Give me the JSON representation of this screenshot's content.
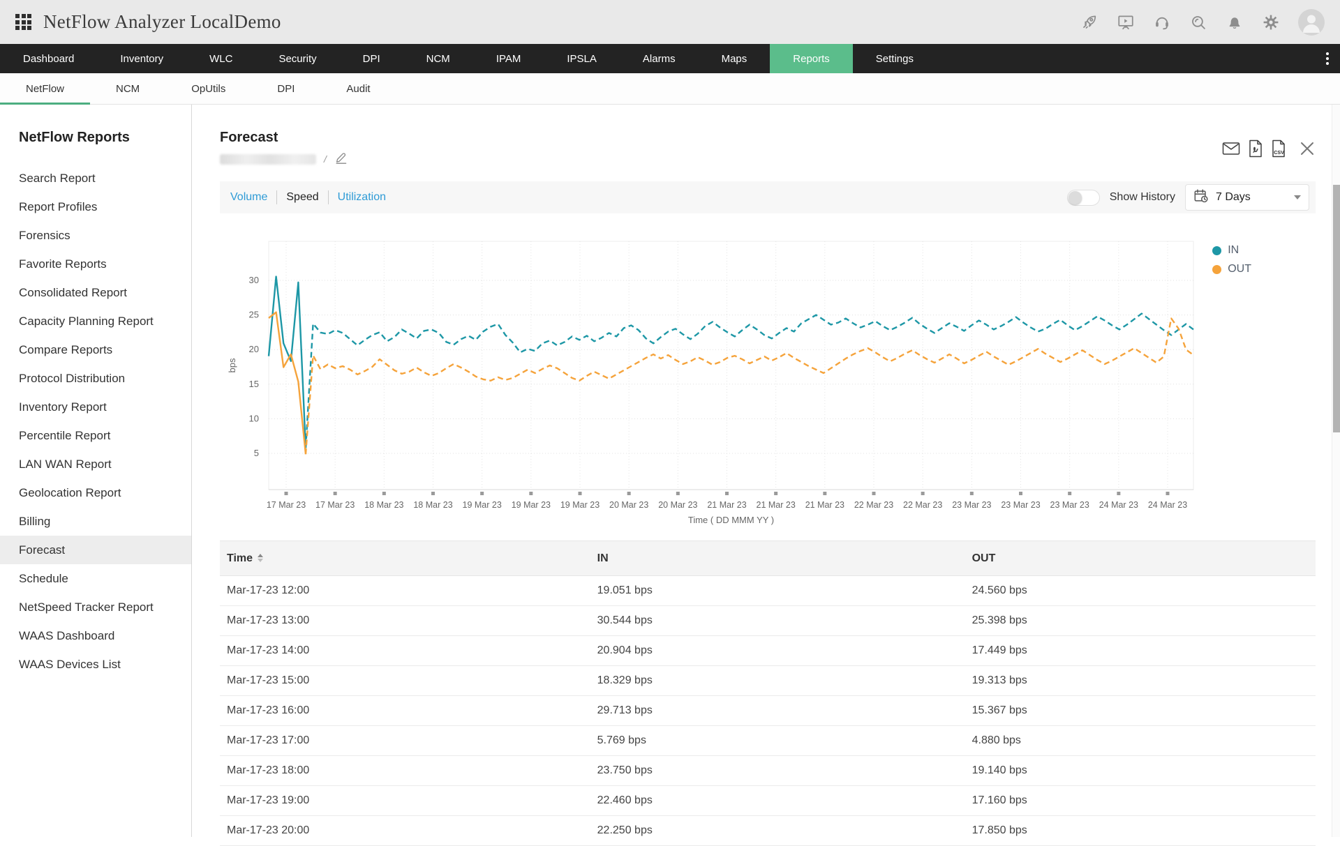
{
  "topbar": {
    "title": "NetFlow Analyzer LocalDemo",
    "icons": [
      "apps-grid-icon",
      "rocket-icon",
      "presentation-icon",
      "headset-icon",
      "search-icon",
      "bell-icon",
      "gear-icon",
      "avatar"
    ]
  },
  "navbar": {
    "items": [
      "Dashboard",
      "Inventory",
      "WLC",
      "Security",
      "DPI",
      "NCM",
      "IPAM",
      "IPSLA",
      "Alarms",
      "Maps",
      "Reports",
      "Settings"
    ],
    "active": "Reports"
  },
  "subnav": {
    "items": [
      "NetFlow",
      "NCM",
      "OpUtils",
      "DPI",
      "Audit"
    ],
    "active": "NetFlow"
  },
  "sidebar": {
    "title": "NetFlow Reports",
    "items": [
      "Search Report",
      "Report Profiles",
      "Forensics",
      "Favorite Reports",
      "Consolidated Report",
      "Capacity Planning Report",
      "Compare Reports",
      "Protocol Distribution",
      "Inventory Report",
      "Percentile Report",
      "LAN WAN Report",
      "Geolocation Report",
      "Billing",
      "Forecast",
      "Schedule",
      "NetSpeed Tracker Report",
      "WAAS Dashboard",
      "WAAS Devices List"
    ],
    "active": "Forecast"
  },
  "report": {
    "title": "Forecast",
    "edit_separator": "/"
  },
  "view_tabs": {
    "items": [
      "Volume",
      "Speed",
      "Utilization"
    ],
    "active": "Speed"
  },
  "controls": {
    "show_history_label": "Show History",
    "toggle_on": false,
    "period_label": "7 Days"
  },
  "export_icons": [
    "email-icon",
    "pdf-export-icon",
    "csv-export-icon",
    "close-icon"
  ],
  "chart_data": {
    "type": "line",
    "title": "",
    "ylabel": "bps",
    "xlabel": "Time ( DD MMM YY )",
    "ylim": [
      0,
      35
    ],
    "yticks": [
      5,
      10,
      15,
      20,
      25,
      30
    ],
    "grid": "dotted",
    "legend_position": "right-top",
    "x_tick_labels": [
      "17 Mar 23",
      "17 Mar 23",
      "18 Mar 23",
      "18 Mar 23",
      "19 Mar 23",
      "19 Mar 23",
      "19 Mar 23",
      "20 Mar 23",
      "20 Mar 23",
      "21 Mar 23",
      "21 Mar 23",
      "21 Mar 23",
      "22 Mar 23",
      "22 Mar 23",
      "23 Mar 23",
      "23 Mar 23",
      "23 Mar 23",
      "24 Mar 23",
      "24 Mar 23"
    ],
    "history_style": "solid",
    "forecast_style": "dashed",
    "series": [
      {
        "name": "IN",
        "color": "#1d97a6",
        "history": [
          19.051,
          30.544,
          20.904,
          18.329,
          29.713,
          5.769
        ],
        "forecast": [
          23.75,
          22.46,
          22.25,
          22.8,
          22.4,
          21.5,
          20.6,
          21.4,
          22.1,
          22.5,
          21.2,
          21.8,
          22.9,
          22.3,
          21.6,
          22.7,
          22.9,
          22.4,
          21.1,
          20.7,
          21.5,
          22.0,
          21.4,
          22.6,
          23.3,
          23.7,
          22.1,
          21.0,
          19.6,
          20.1,
          19.8,
          20.9,
          21.3,
          20.6,
          21.1,
          21.9,
          21.4,
          22.0,
          21.2,
          21.7,
          22.4,
          21.9,
          23.1,
          23.5,
          22.8,
          21.6,
          20.9,
          21.8,
          22.6,
          23.0,
          22.2,
          21.5,
          22.3,
          23.4,
          24.0,
          23.2,
          22.5,
          21.9,
          22.8,
          23.6,
          22.9,
          22.1,
          21.6,
          22.4,
          23.1,
          22.6,
          23.8,
          24.4,
          25.0,
          24.3,
          23.6,
          23.9,
          24.5,
          23.8,
          23.2,
          23.6,
          24.1,
          23.4,
          22.8,
          23.3,
          23.9,
          24.6,
          23.7,
          23.0,
          22.4,
          23.1,
          23.8,
          23.3,
          22.7,
          23.5,
          24.2,
          23.6,
          22.9,
          23.4,
          24.0,
          24.7,
          23.9,
          23.2,
          22.6,
          23.0,
          23.7,
          24.3,
          23.5,
          22.8,
          23.4,
          24.1,
          24.8,
          24.2,
          23.5,
          22.9,
          23.6,
          24.4,
          25.2,
          24.4,
          23.6,
          22.8,
          22.1,
          22.9,
          23.7,
          22.9
        ]
      },
      {
        "name": "OUT",
        "color": "#f5a33b",
        "history": [
          24.56,
          25.398,
          17.449,
          19.313,
          15.367,
          4.88
        ],
        "forecast": [
          19.14,
          17.16,
          17.85,
          17.3,
          17.6,
          17.1,
          16.4,
          16.9,
          17.5,
          18.6,
          17.8,
          17.0,
          16.5,
          16.8,
          17.4,
          16.7,
          16.2,
          16.6,
          17.3,
          17.9,
          17.4,
          16.8,
          16.1,
          15.7,
          15.5,
          16.0,
          15.6,
          15.9,
          16.5,
          17.1,
          16.6,
          17.2,
          17.7,
          17.3,
          16.6,
          15.9,
          15.5,
          16.2,
          16.8,
          16.3,
          15.8,
          16.4,
          17.0,
          17.6,
          18.2,
          18.8,
          19.3,
          18.7,
          19.2,
          18.5,
          17.9,
          18.3,
          18.9,
          18.4,
          17.8,
          18.2,
          18.8,
          19.1,
          18.6,
          18.0,
          18.5,
          19.0,
          18.4,
          18.9,
          19.5,
          18.8,
          18.2,
          17.6,
          17.1,
          16.6,
          17.3,
          18.0,
          18.7,
          19.3,
          19.8,
          20.2,
          19.6,
          18.9,
          18.3,
          18.8,
          19.4,
          19.9,
          19.2,
          18.6,
          18.1,
          18.7,
          19.3,
          18.7,
          18.0,
          18.5,
          19.1,
          19.7,
          19.0,
          18.4,
          17.8,
          18.3,
          18.9,
          19.5,
          20.1,
          19.4,
          18.8,
          18.2,
          18.7,
          19.3,
          19.9,
          19.2,
          18.5,
          17.9,
          18.4,
          19.0,
          19.6,
          20.2,
          19.5,
          18.8,
          18.1,
          19.0,
          24.5,
          23.0,
          20.0,
          19.2
        ]
      }
    ]
  },
  "table": {
    "columns": [
      "Time",
      "IN",
      "OUT"
    ],
    "rows": [
      [
        "Mar-17-23 12:00",
        "19.051 bps",
        "24.560 bps"
      ],
      [
        "Mar-17-23 13:00",
        "30.544 bps",
        "25.398 bps"
      ],
      [
        "Mar-17-23 14:00",
        "20.904 bps",
        "17.449 bps"
      ],
      [
        "Mar-17-23 15:00",
        "18.329 bps",
        "19.313 bps"
      ],
      [
        "Mar-17-23 16:00",
        "29.713 bps",
        "15.367 bps"
      ],
      [
        "Mar-17-23 17:00",
        "5.769 bps",
        "4.880 bps"
      ],
      [
        "Mar-17-23 18:00",
        "23.750 bps",
        "19.140 bps"
      ],
      [
        "Mar-17-23 19:00",
        "22.460 bps",
        "17.160 bps"
      ],
      [
        "Mar-17-23 20:00",
        "22.250 bps",
        "17.850 bps"
      ]
    ]
  },
  "colors": {
    "nav_active": "#5bbd8b",
    "subnav_underline": "#4cae80",
    "link_blue": "#2e9bd6",
    "series_in": "#1d97a6",
    "series_out": "#f5a33b"
  }
}
